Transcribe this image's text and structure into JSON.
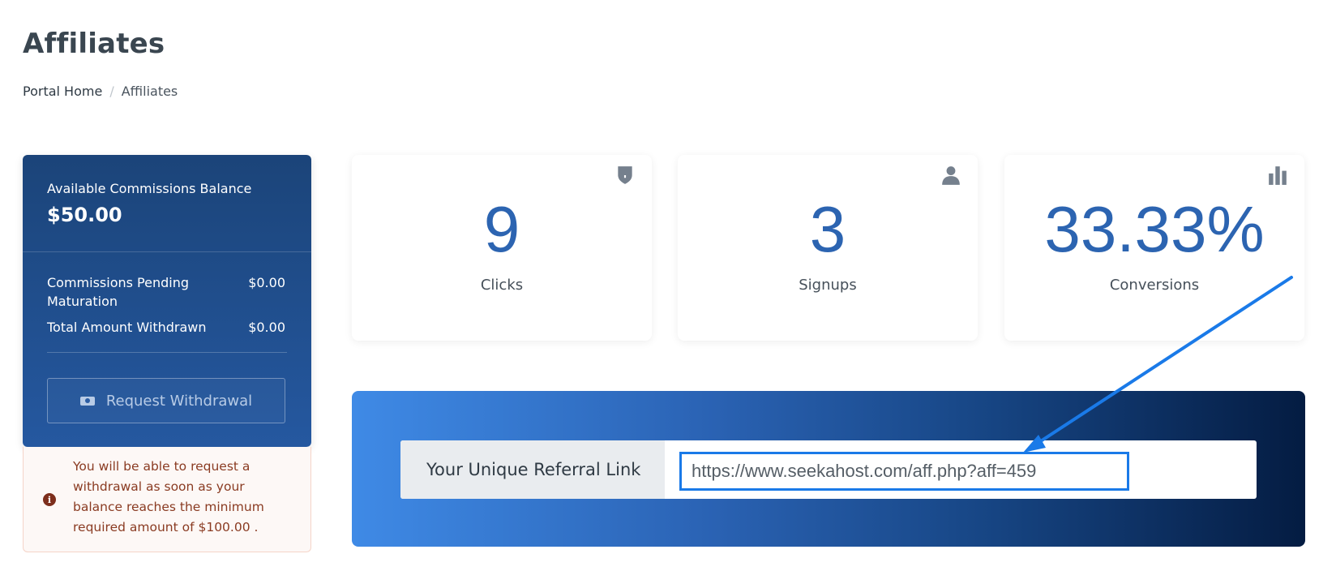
{
  "page": {
    "title": "Affiliates"
  },
  "breadcrumb": {
    "home": "Portal Home",
    "separator": "/",
    "current": "Affiliates"
  },
  "balance": {
    "available_label": "Available Commissions Balance",
    "available_value": "$50.00",
    "pending_label": "Commissions Pending Maturation",
    "pending_value": "$0.00",
    "withdrawn_label": "Total Amount Withdrawn",
    "withdrawn_value": "$0.00",
    "withdraw_button": "Request Withdrawal"
  },
  "notice": {
    "text": "You will be able to request a withdrawal as soon as your balance reaches the minimum required amount of $100.00 ."
  },
  "stats": [
    {
      "value": "9",
      "label": "Clicks",
      "icon": "shield-icon"
    },
    {
      "value": "3",
      "label": "Signups",
      "icon": "user-icon"
    },
    {
      "value": "33.33%",
      "label": "Conversions",
      "icon": "bar-chart-icon"
    }
  ],
  "referral": {
    "label": "Your Unique Referral Link",
    "url": "https://www.seekahost.com/aff.php?aff=459"
  },
  "colors": {
    "accent": "#2c64b1",
    "highlight": "#1a7ae8",
    "card": "#1b4479"
  }
}
